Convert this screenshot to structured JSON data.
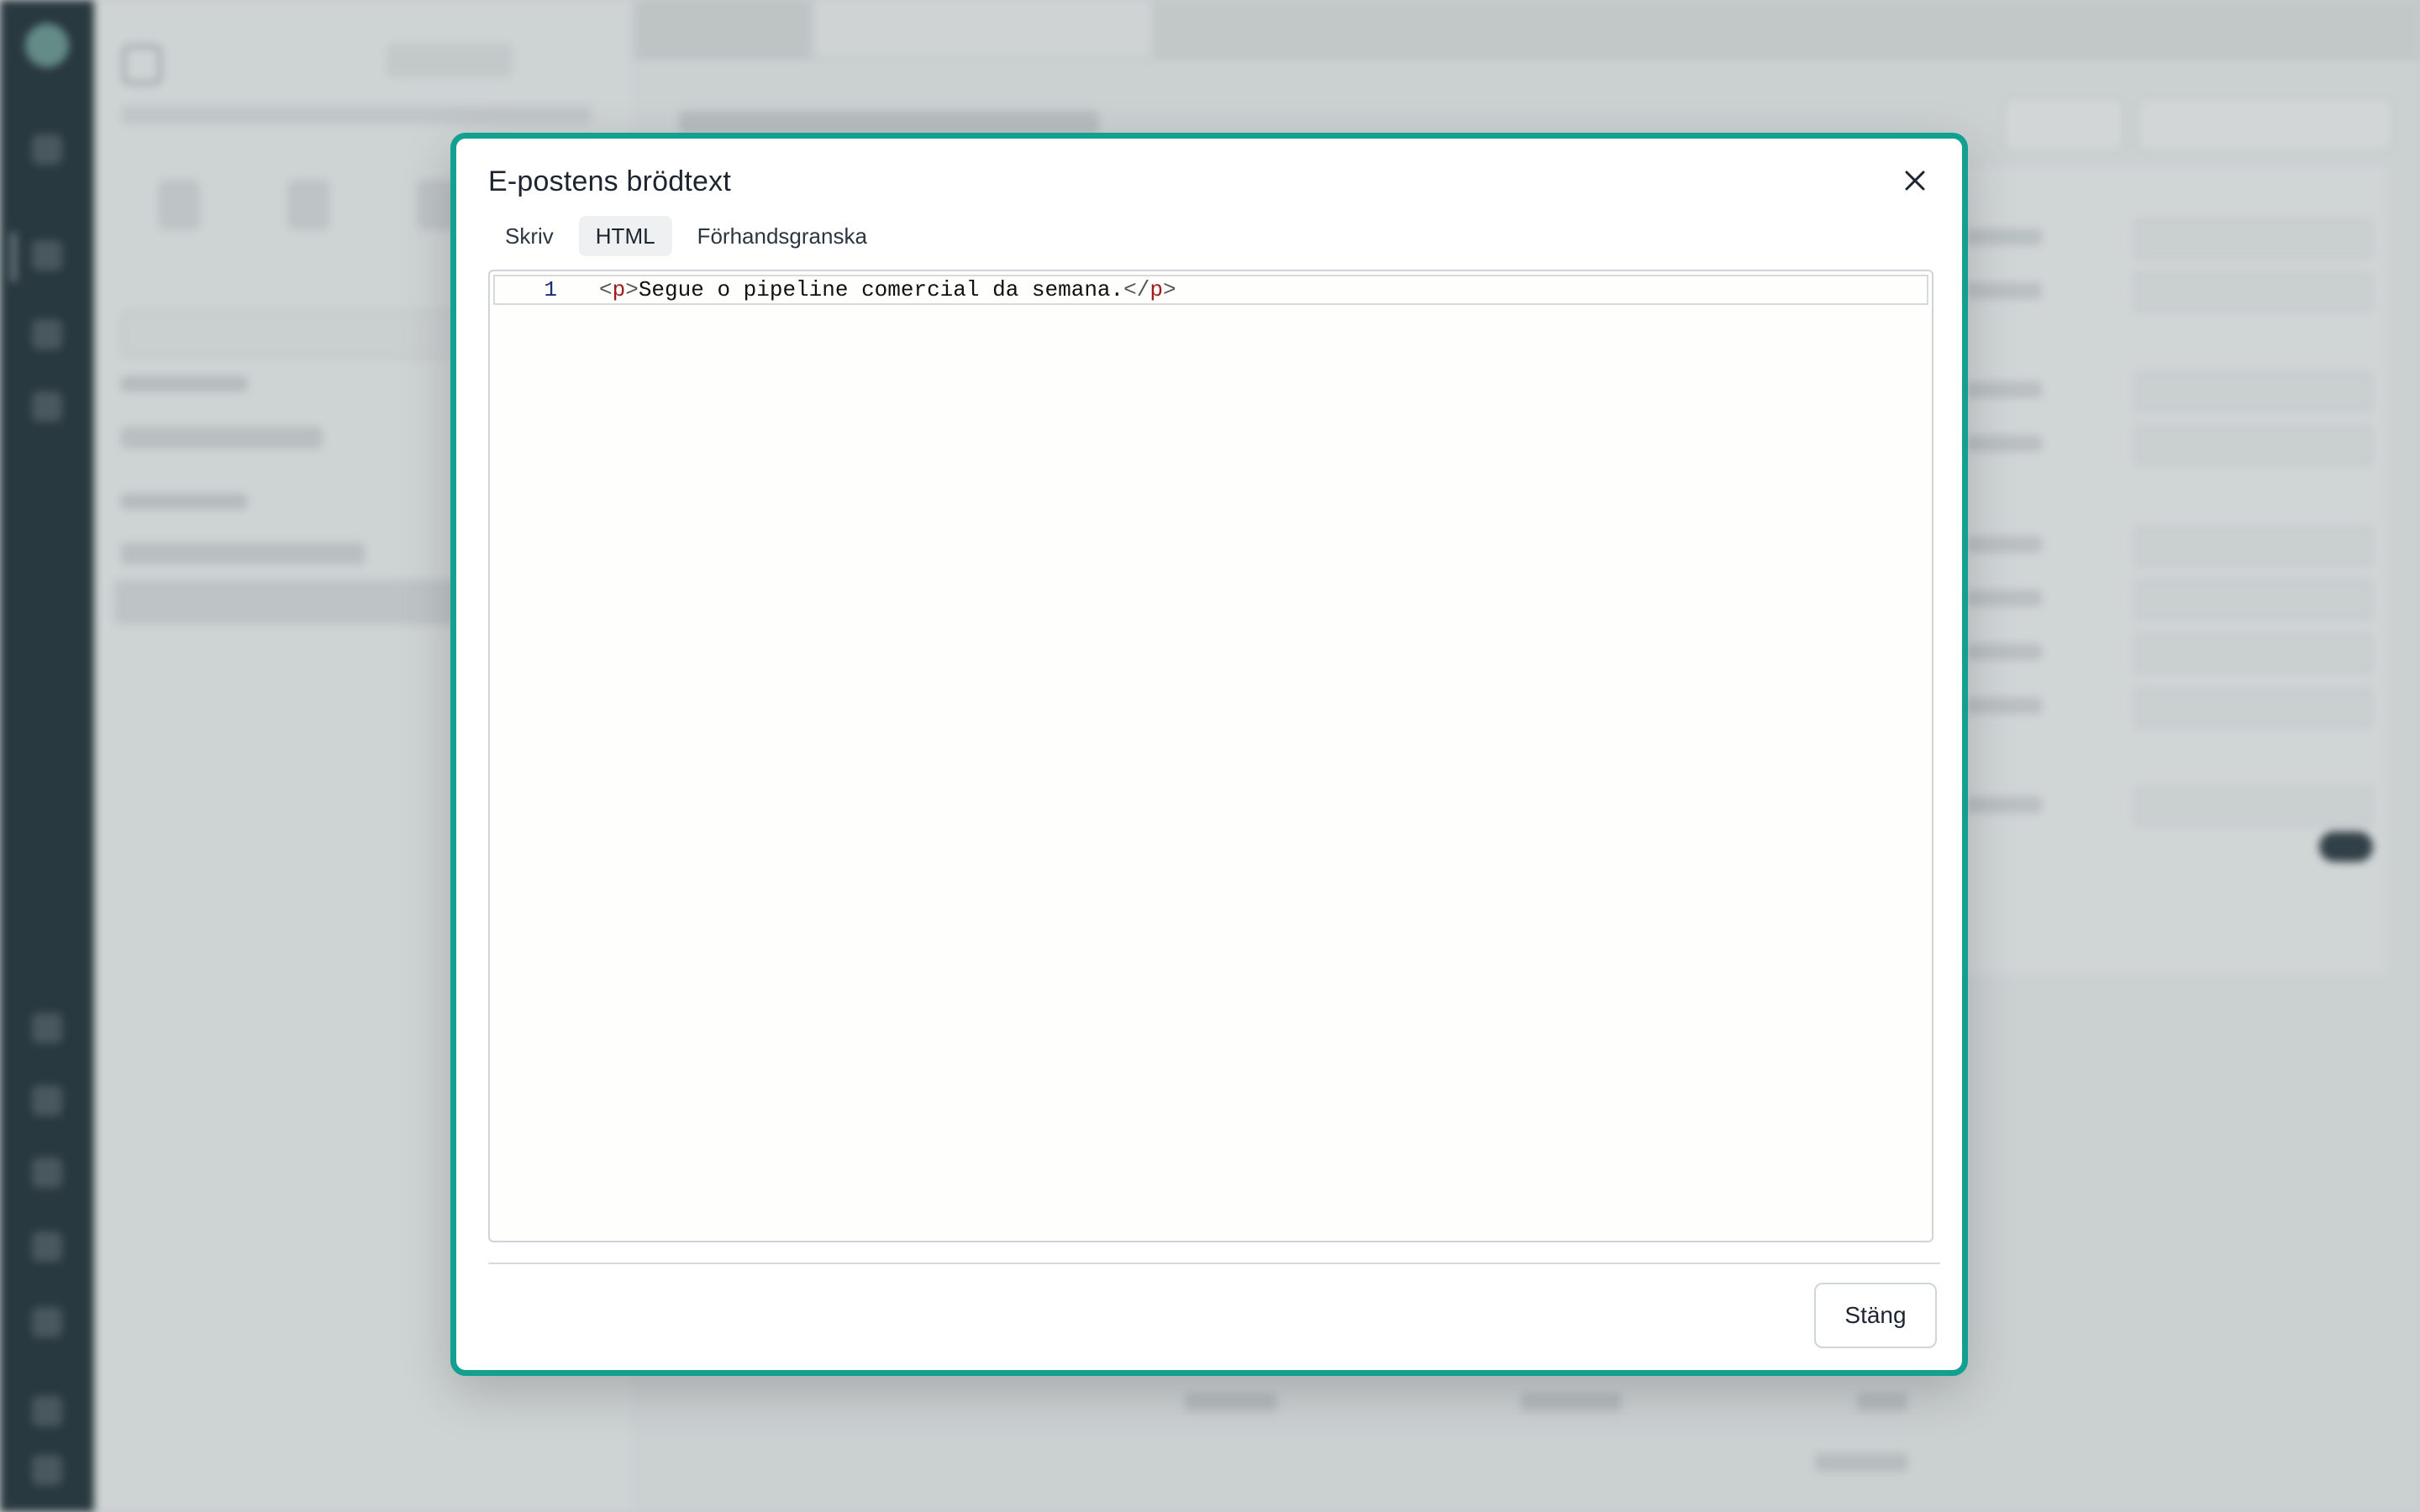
{
  "dialog": {
    "title": "E-postens brödtext",
    "tabs": [
      {
        "label": "Skriv",
        "active": false
      },
      {
        "label": "HTML",
        "active": true
      },
      {
        "label": "Förhandsgranska",
        "active": false
      }
    ],
    "editor": {
      "line_number": "1",
      "code": {
        "open_bracket": "<",
        "open_tag": "p",
        "open_close_bracket": ">",
        "text": "Segue o pipeline comercial da semana.",
        "end_bracket": "</",
        "end_tag": "p",
        "end_close_bracket": ">"
      }
    },
    "close_button_label": "Stäng",
    "close_icon": "close-icon"
  },
  "colors": {
    "accent_border": "#14a090",
    "sidebar_rail": "#13242c"
  }
}
